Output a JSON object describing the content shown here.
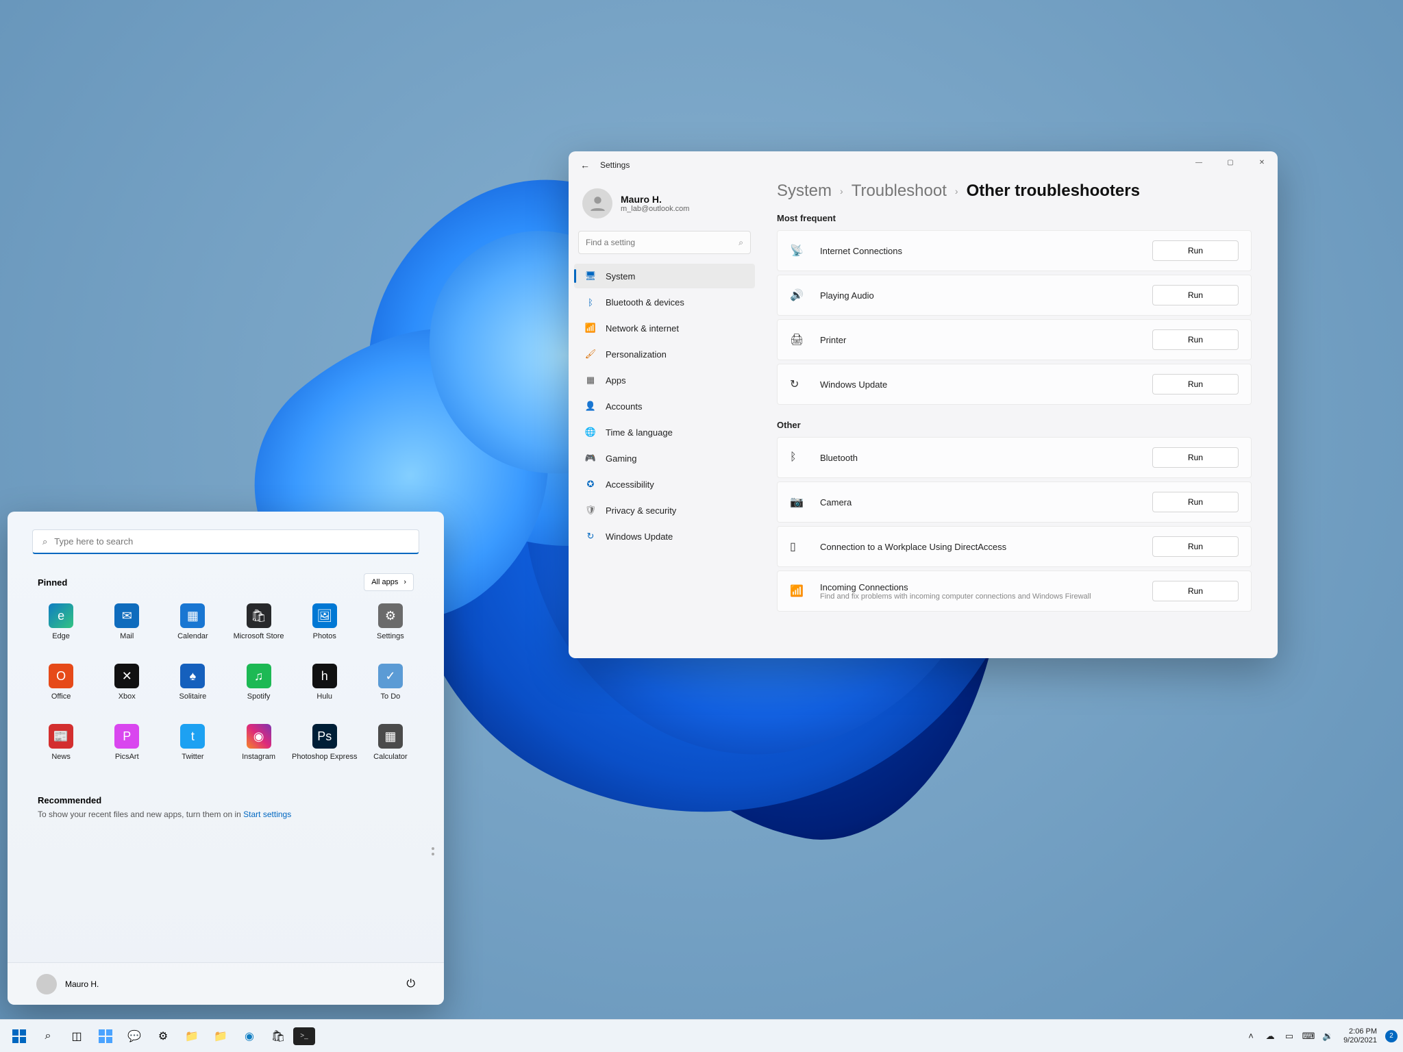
{
  "settings": {
    "title": "Settings",
    "user": {
      "name": "Mauro H.",
      "email": "m_lab@outlook.com"
    },
    "search_placeholder": "Find a setting",
    "nav": [
      {
        "label": "System",
        "icon": "🖥",
        "active": true,
        "color": "#0067c0"
      },
      {
        "label": "Bluetooth & devices",
        "icon": "ᛒ",
        "color": "#0067c0"
      },
      {
        "label": "Network & internet",
        "icon": "📶",
        "color": "#0099e5"
      },
      {
        "label": "Personalization",
        "icon": "🖌",
        "color": "#d86c00"
      },
      {
        "label": "Apps",
        "icon": "▦",
        "color": "#555"
      },
      {
        "label": "Accounts",
        "icon": "👤",
        "color": "#00a2b4"
      },
      {
        "label": "Time & language",
        "icon": "🌐",
        "color": "#555"
      },
      {
        "label": "Gaming",
        "icon": "🎮",
        "color": "#666"
      },
      {
        "label": "Accessibility",
        "icon": "✪",
        "color": "#0067c0"
      },
      {
        "label": "Privacy & security",
        "icon": "🛡",
        "color": "#777"
      },
      {
        "label": "Windows Update",
        "icon": "↻",
        "color": "#0067c0"
      }
    ],
    "breadcrumb": {
      "a": "System",
      "b": "Troubleshoot",
      "c": "Other troubleshooters"
    },
    "sections": {
      "most_frequent": {
        "title": "Most frequent",
        "items": [
          {
            "icon": "📡",
            "label": "Internet Connections",
            "run": "Run"
          },
          {
            "icon": "🔊",
            "label": "Playing Audio",
            "run": "Run"
          },
          {
            "icon": "🖨",
            "label": "Printer",
            "run": "Run"
          },
          {
            "icon": "↻",
            "label": "Windows Update",
            "run": "Run"
          }
        ]
      },
      "other": {
        "title": "Other",
        "items": [
          {
            "icon": "ᛒ",
            "label": "Bluetooth",
            "run": "Run"
          },
          {
            "icon": "📷",
            "label": "Camera",
            "run": "Run"
          },
          {
            "icon": "▯",
            "label": "Connection to a Workplace Using DirectAccess",
            "run": "Run"
          },
          {
            "icon": "📶",
            "label": "Incoming Connections",
            "sub": "Find and fix problems with incoming computer connections and Windows Firewall",
            "run": "Run"
          }
        ]
      }
    }
  },
  "start": {
    "search_placeholder": "Type here to search",
    "pinned_title": "Pinned",
    "all_apps": "All apps",
    "pinned": [
      {
        "label": "Edge",
        "bg": "linear-gradient(135deg,#0f7dc2,#33c481)",
        "glyph": "e"
      },
      {
        "label": "Mail",
        "bg": "#0f6cbd",
        "glyph": "✉"
      },
      {
        "label": "Calendar",
        "bg": "#1976d2",
        "glyph": "▦"
      },
      {
        "label": "Microsoft Store",
        "bg": "#28292b",
        "glyph": "🛍"
      },
      {
        "label": "Photos",
        "bg": "#0278d4",
        "glyph": "🖼"
      },
      {
        "label": "Settings",
        "bg": "#6b6b6b",
        "glyph": "⚙"
      },
      {
        "label": "Office",
        "bg": "#e64a19",
        "glyph": "O"
      },
      {
        "label": "Xbox",
        "bg": "#111",
        "glyph": "✕"
      },
      {
        "label": "Solitaire",
        "bg": "#1560bd",
        "glyph": "♠"
      },
      {
        "label": "Spotify",
        "bg": "#1db954",
        "glyph": "♫"
      },
      {
        "label": "Hulu",
        "bg": "#111",
        "glyph": "h"
      },
      {
        "label": "To Do",
        "bg": "#5b9bd5",
        "glyph": "✓"
      },
      {
        "label": "News",
        "bg": "#d32f2f",
        "glyph": "📰"
      },
      {
        "label": "PicsArt",
        "bg": "#d946ef",
        "glyph": "P"
      },
      {
        "label": "Twitter",
        "bg": "#1da1f2",
        "glyph": "t"
      },
      {
        "label": "Instagram",
        "bg": "linear-gradient(45deg,#f58529,#dd2a7b,#8134af)",
        "glyph": "◉"
      },
      {
        "label": "Photoshop Express",
        "bg": "#001e36",
        "glyph": "Ps"
      },
      {
        "label": "Calculator",
        "bg": "#4b4b4b",
        "glyph": "▦"
      }
    ],
    "recommended_title": "Recommended",
    "recommended_text": "To show your recent files and new apps, turn them on in ",
    "recommended_link": "Start settings",
    "user": "Mauro H."
  },
  "taskbar": {
    "tray": {
      "time": "2:06 PM",
      "date": "9/20/2021",
      "notif_count": "2"
    }
  }
}
